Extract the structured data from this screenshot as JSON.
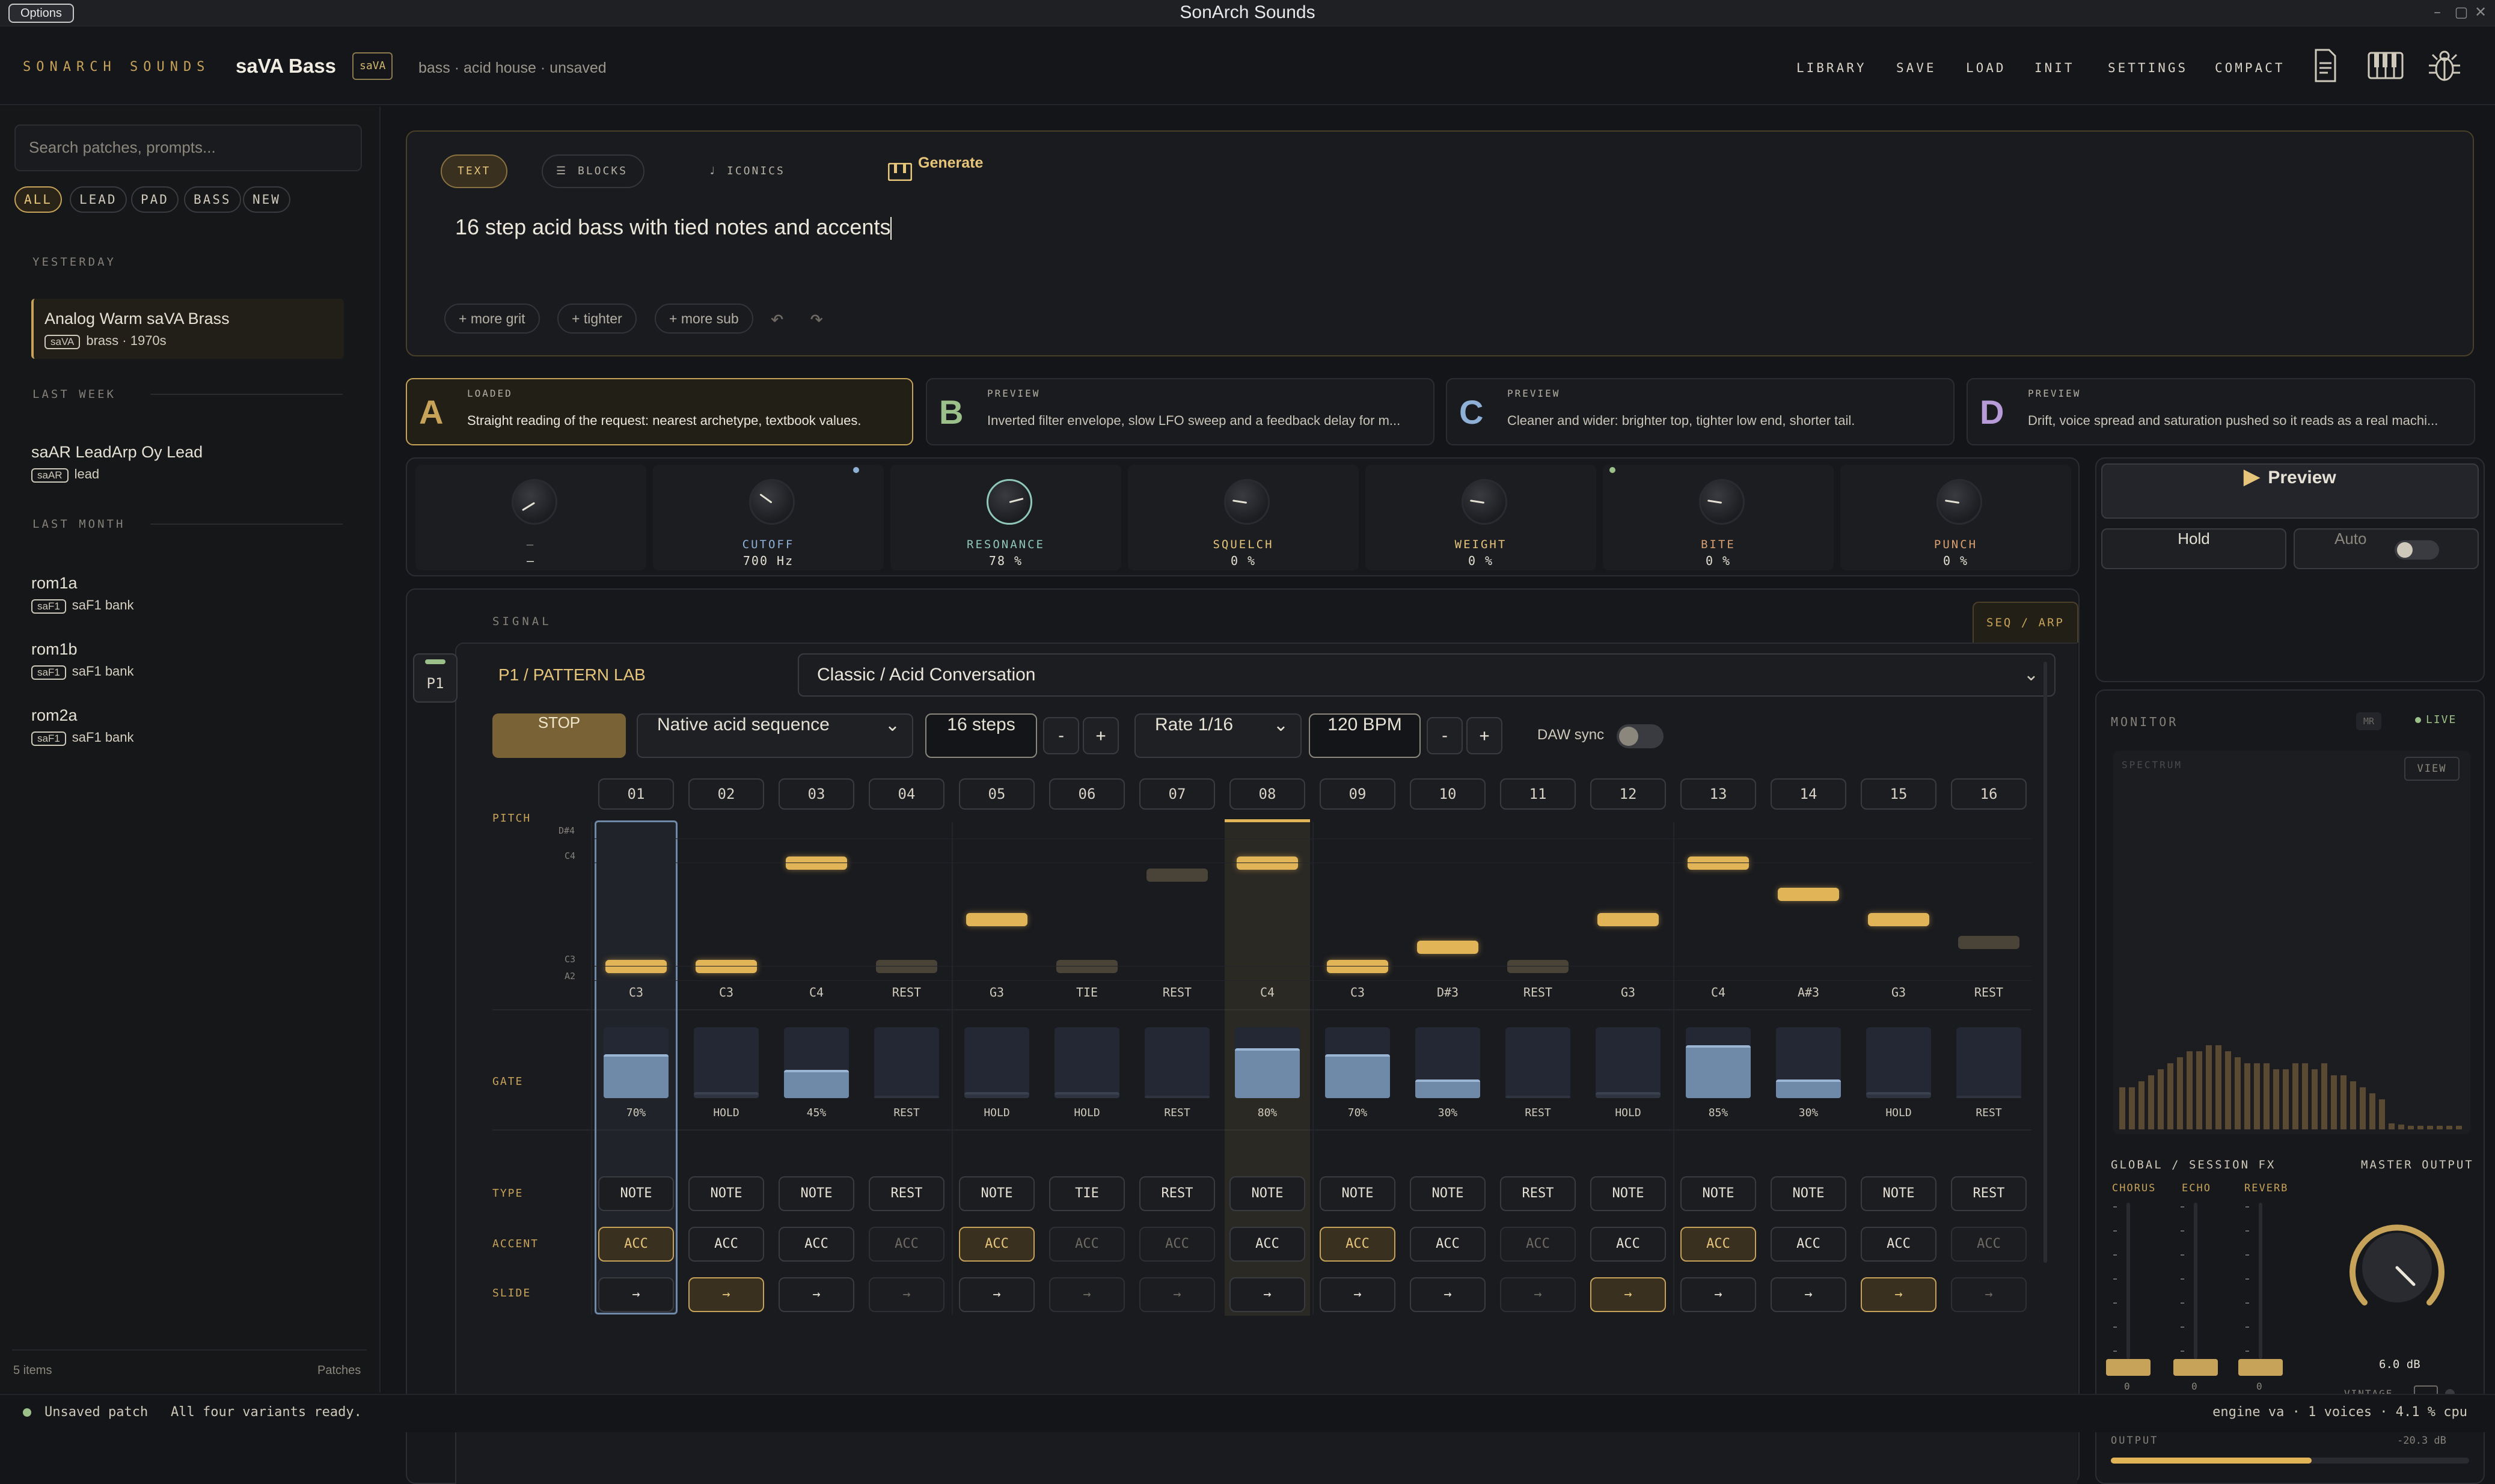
{
  "window": {
    "title": "SonArch Sounds",
    "options_label": "Options"
  },
  "header": {
    "brand": "SONARCH SOUNDS",
    "patch_name": "saVA Bass",
    "engine_tag": "saVA",
    "subtitle": "bass · acid house · unsaved",
    "nav": [
      "LIBRARY",
      "SAVE",
      "LOAD",
      "INIT",
      "SETTINGS",
      "COMPACT"
    ],
    "icons": [
      "document-icon",
      "piano-icon",
      "bug-icon"
    ]
  },
  "sidebar": {
    "search_placeholder": "Search patches, prompts...",
    "filters": [
      "ALL",
      "LEAD",
      "PAD",
      "BASS",
      "NEW"
    ],
    "groups": [
      {
        "label": "YESTERDAY",
        "items": [
          {
            "title": "Analog Warm saVA Brass",
            "tag": "saVA",
            "sub": "brass · 1970s",
            "selected": true
          }
        ]
      },
      {
        "label": "LAST WEEK",
        "items": [
          {
            "title": "saAR LeadArp Oy Lead",
            "tag": "saAR",
            "sub": "lead"
          }
        ]
      },
      {
        "label": "LAST MONTH",
        "items": [
          {
            "title": "rom1a",
            "tag": "saF1",
            "sub": "saF1 bank"
          },
          {
            "title": "rom1b",
            "tag": "saF1",
            "sub": "saF1 bank"
          },
          {
            "title": "rom2a",
            "tag": "saF1",
            "sub": "saF1 bank"
          }
        ]
      }
    ],
    "footer_count": "5 items",
    "footer_label": "Patches"
  },
  "prompt": {
    "modes": [
      "TEXT",
      "BLOCKS",
      "ICONICS"
    ],
    "generate_label": "Generate",
    "text": "16 step acid bass with tied notes and accents",
    "chips": [
      "+ more grit",
      "+ tighter",
      "+ more sub"
    ]
  },
  "variants": [
    {
      "letter": "A",
      "state": "LOADED",
      "desc": "Straight reading of the request: nearest archetype, textbook values.",
      "color": "#c7a35a"
    },
    {
      "letter": "B",
      "state": "PREVIEW",
      "desc": "Inverted filter envelope, slow LFO sweep and a feedback delay for m...",
      "color": "#9cc08a"
    },
    {
      "letter": "C",
      "state": "PREVIEW",
      "desc": "Cleaner and wider: brighter top, tighter low end, shorter tail.",
      "color": "#8fb0d6"
    },
    {
      "letter": "D",
      "state": "PREVIEW",
      "desc": "Drift, voice spread and saturation pushed so it reads as a real machi...",
      "color": "#b79ad8"
    }
  ],
  "macros": [
    {
      "label": "–",
      "value": "–",
      "color": "#8b877d",
      "level": 0.05
    },
    {
      "label": "CUTOFF",
      "value": "700 Hz",
      "color": "#8fb0d6",
      "level": 0.3
    },
    {
      "label": "RESONANCE",
      "value": "78 %",
      "color": "#8fc7b8",
      "level": 0.78
    },
    {
      "label": "SQUELCH",
      "value": "0 %",
      "color": "#e6c57b",
      "level": 0.2
    },
    {
      "label": "WEIGHT",
      "value": "0 %",
      "color": "#e6c57b",
      "level": 0.2
    },
    {
      "label": "BITE",
      "value": "0 %",
      "color": "#d8a070",
      "level": 0.2
    },
    {
      "label": "PUNCH",
      "value": "0 %",
      "color": "#d8a070",
      "level": 0.2
    }
  ],
  "preview": {
    "label": "Preview",
    "hold": "Hold",
    "auto": "Auto"
  },
  "signal": {
    "section_label": "SIGNAL",
    "tab": "SEQ / ARP",
    "slot": "P1",
    "title": "P1 / PATTERN LAB",
    "preset": "Classic / Acid Conversation",
    "stop": "STOP",
    "mode": "Native acid sequence",
    "steps": "16 steps",
    "rate": "Rate 1/16",
    "bpm": "120 BPM",
    "minus": "-",
    "plus": "+",
    "daw_sync": "DAW sync",
    "row_labels": {
      "pitch": "PITCH",
      "gate": "GATE",
      "type": "TYPE",
      "accent": "ACCENT",
      "slide": "SLIDE"
    },
    "pitch_marks": [
      "D#4",
      "C4",
      "C3",
      "A2"
    ],
    "steps_data": [
      {
        "n": "01",
        "note": "C3",
        "gate": "70%",
        "gate_level": 0.7,
        "type": "NOTE",
        "accent": "ACC",
        "acc_on": true,
        "slide_on": false
      },
      {
        "n": "02",
        "note": "C3",
        "gate": "HOLD",
        "gate_level": 0.1,
        "type": "NOTE",
        "accent": "ACC",
        "acc_on": false,
        "slide_on": true
      },
      {
        "n": "03",
        "note": "C4",
        "gate": "45%",
        "gate_level": 0.45,
        "type": "NOTE",
        "accent": "ACC",
        "acc_on": false,
        "slide_on": false
      },
      {
        "n": "04",
        "note": "REST",
        "gate": "REST",
        "gate_level": 0,
        "type": "REST",
        "accent": "ACC",
        "acc_on": false,
        "slide_on": false,
        "off": true
      },
      {
        "n": "05",
        "note": "G3",
        "gate": "HOLD",
        "gate_level": 0.1,
        "type": "NOTE",
        "accent": "ACC",
        "acc_on": true,
        "slide_on": false
      },
      {
        "n": "06",
        "note": "TIE",
        "gate": "HOLD",
        "gate_level": 0.1,
        "type": "TIE",
        "accent": "ACC",
        "acc_on": false,
        "slide_on": false,
        "off": true
      },
      {
        "n": "07",
        "note": "REST",
        "gate": "REST",
        "gate_level": 0,
        "type": "REST",
        "accent": "ACC",
        "acc_on": false,
        "slide_on": false,
        "off": true
      },
      {
        "n": "08",
        "note": "C4",
        "gate": "80%",
        "gate_level": 0.8,
        "type": "NOTE",
        "accent": "ACC",
        "acc_on": false,
        "slide_on": false
      },
      {
        "n": "09",
        "note": "C3",
        "gate": "70%",
        "gate_level": 0.7,
        "type": "NOTE",
        "accent": "ACC",
        "acc_on": true,
        "slide_on": false
      },
      {
        "n": "10",
        "note": "D#3",
        "gate": "30%",
        "gate_level": 0.3,
        "type": "NOTE",
        "accent": "ACC",
        "acc_on": false,
        "slide_on": false
      },
      {
        "n": "11",
        "note": "REST",
        "gate": "REST",
        "gate_level": 0,
        "type": "REST",
        "accent": "ACC",
        "acc_on": false,
        "slide_on": false,
        "off": true
      },
      {
        "n": "12",
        "note": "G3",
        "gate": "HOLD",
        "gate_level": 0.1,
        "type": "NOTE",
        "accent": "ACC",
        "acc_on": false,
        "slide_on": true
      },
      {
        "n": "13",
        "note": "C4",
        "gate": "85%",
        "gate_level": 0.85,
        "type": "NOTE",
        "accent": "ACC",
        "acc_on": true,
        "slide_on": false
      },
      {
        "n": "14",
        "note": "A#3",
        "gate": "30%",
        "gate_level": 0.3,
        "type": "NOTE",
        "accent": "ACC",
        "acc_on": false,
        "slide_on": false
      },
      {
        "n": "15",
        "note": "G3",
        "gate": "HOLD",
        "gate_level": 0.1,
        "type": "NOTE",
        "accent": "ACC",
        "acc_on": false,
        "slide_on": true
      },
      {
        "n": "16",
        "note": "REST",
        "gate": "REST",
        "gate_level": 0,
        "type": "REST",
        "accent": "ACC",
        "acc_on": false,
        "slide_on": false,
        "off": true
      }
    ]
  },
  "monitor": {
    "label": "MONITOR",
    "mode_chip": "MR",
    "live": "LIVE",
    "spectrum": "SPECTRUM",
    "view": "VIEW",
    "fx_title": "GLOBAL / SESSION FX",
    "fx": [
      "CHORUS",
      "ECHO",
      "REVERB"
    ],
    "fx_values": [
      "0",
      "0",
      "0"
    ],
    "master_title": "MASTER OUTPUT",
    "master_value": "6.0 dB",
    "vintage": "VINTAGE",
    "output_label": "OUTPUT",
    "output_value": "-20.3 dB",
    "output_level": 0.56
  },
  "status": {
    "left": "Unsaved patch",
    "message": "All four variants ready.",
    "right": "engine va · 1 voices · 4.1 % cpu"
  }
}
